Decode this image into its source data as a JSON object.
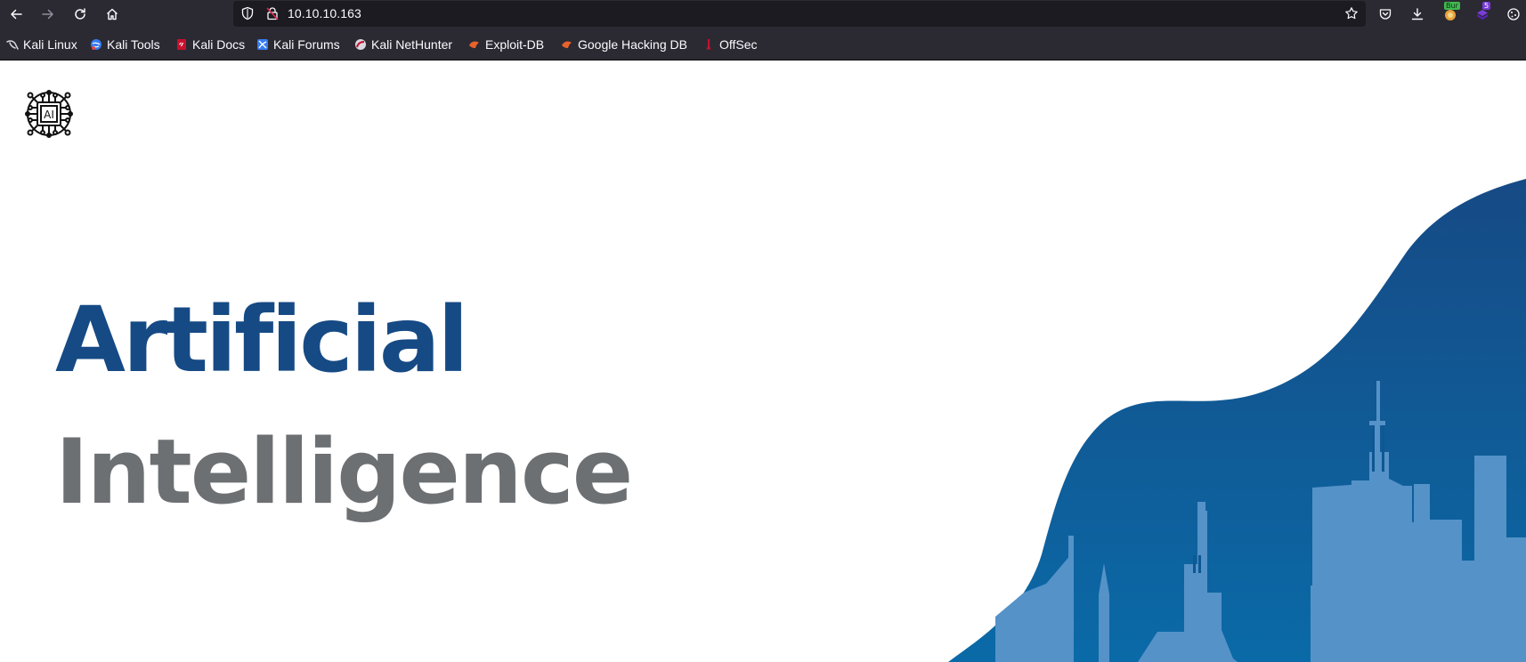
{
  "browser": {
    "url": "10.10.10.163",
    "nav": {
      "back": "back-arrow-icon",
      "forward": "forward-arrow-icon",
      "reload": "reload-icon",
      "home": "home-icon"
    },
    "toolbar_icons": [
      "pocket-icon",
      "download-icon",
      "burp-extension-icon",
      "extension-icon",
      "cookie-icon"
    ],
    "extension_badges": {
      "burp": "Bur",
      "count": "5"
    },
    "colors": {
      "chrome": "#2b2a33",
      "urlbar": "#1c1b22",
      "text": "#fbfbfe"
    }
  },
  "bookmarks": [
    {
      "label": "Kali Linux",
      "icon": "kali-dragon-icon"
    },
    {
      "label": "Kali Tools",
      "icon": "kali-tools-icon"
    },
    {
      "label": "Kali Docs",
      "icon": "kali-docs-icon"
    },
    {
      "label": "Kali Forums",
      "icon": "kali-forums-icon"
    },
    {
      "label": "Kali NetHunter",
      "icon": "nethunter-icon"
    },
    {
      "label": "Exploit-DB",
      "icon": "exploit-db-icon"
    },
    {
      "label": "Google Hacking DB",
      "icon": "ghdb-icon"
    },
    {
      "label": "OffSec",
      "icon": "offsec-icon"
    }
  ],
  "page": {
    "logo_text": "AI",
    "title_line_1": "Artificial",
    "title_line_2": "Intelligence",
    "colors": {
      "title_primary": "#164a85",
      "title_secondary": "#6d7073",
      "wave_top": "#164a85",
      "wave_bottom": "#0a6aa7",
      "skyline": "#5592c8"
    }
  }
}
